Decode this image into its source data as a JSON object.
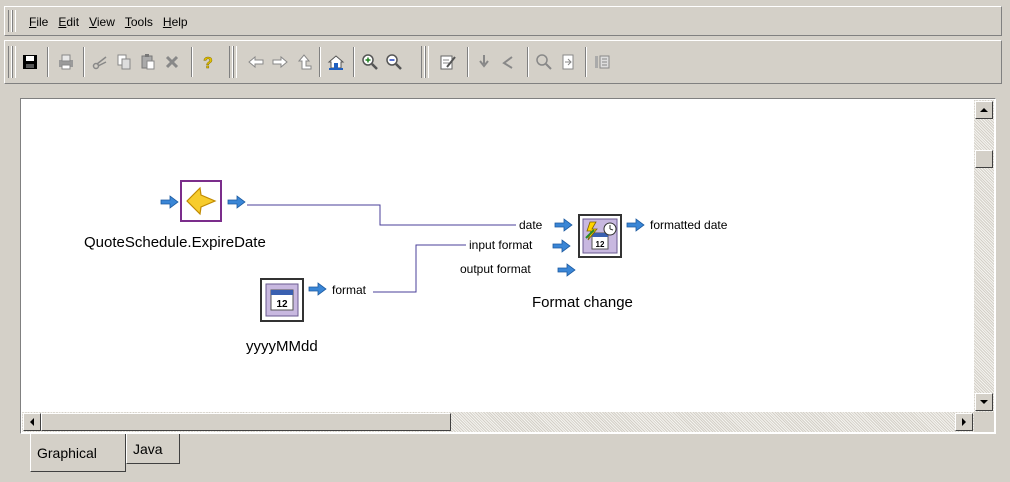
{
  "menu": {
    "items": [
      {
        "accel": "F",
        "rest": "ile"
      },
      {
        "accel": "E",
        "rest": "dit"
      },
      {
        "accel": "V",
        "rest": "iew"
      },
      {
        "accel": "T",
        "rest": "ools"
      },
      {
        "accel": "H",
        "rest": "elp"
      }
    ]
  },
  "toolbar": {
    "buttons": [
      "save-icon",
      "print-icon",
      "cut-icon",
      "copy-icon",
      "paste-icon",
      "delete-icon",
      "help-icon",
      "back-icon",
      "forward-icon",
      "up-icon",
      "home-icon",
      "zoom-in-icon",
      "zoom-out-icon",
      "edit-properties-icon",
      "step-into-icon",
      "step-out-icon",
      "find-icon",
      "export-icon",
      "layout-icon"
    ]
  },
  "canvas": {
    "source_node": {
      "label": "QuoteSchedule.ExpireDate"
    },
    "constant_node": {
      "label": "yyyyMMdd",
      "output_port": "format"
    },
    "transform_node": {
      "label": "Format change",
      "inputs": [
        "date",
        "input format",
        "output format"
      ],
      "output": "formatted date"
    }
  },
  "tabs": {
    "graphical": "Graphical",
    "java": "Java"
  },
  "colors": {
    "connector": "#4a3f9a",
    "port_arrow": "#3a86d6",
    "node_border": "#7b2d8b"
  }
}
